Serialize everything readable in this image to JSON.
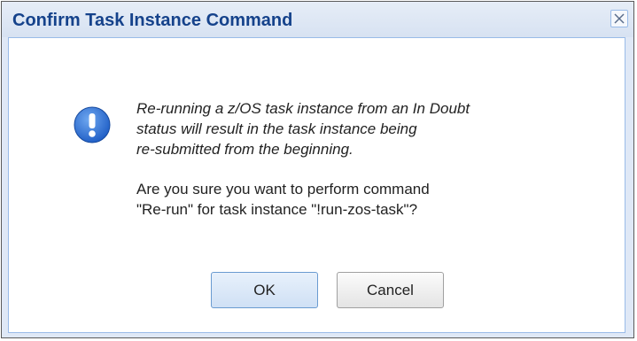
{
  "dialog": {
    "title": "Confirm Task Instance Command",
    "close_icon": "close-icon",
    "info_icon": "exclamation-info-icon",
    "message_warning_lines": [
      "Re-running a z/OS task instance from an In Doubt",
      "status will result in the task instance being",
      "re-submitted from the beginning."
    ],
    "message_question_lines": [
      "Are you sure you want to perform command",
      "\"Re-run\" for task instance \"!run-zos-task\"?"
    ],
    "ok_label": "OK",
    "cancel_label": "Cancel",
    "colors": {
      "title": "#15428b",
      "frame": "#dfe8f6",
      "icon": "#2f6fd8"
    }
  }
}
